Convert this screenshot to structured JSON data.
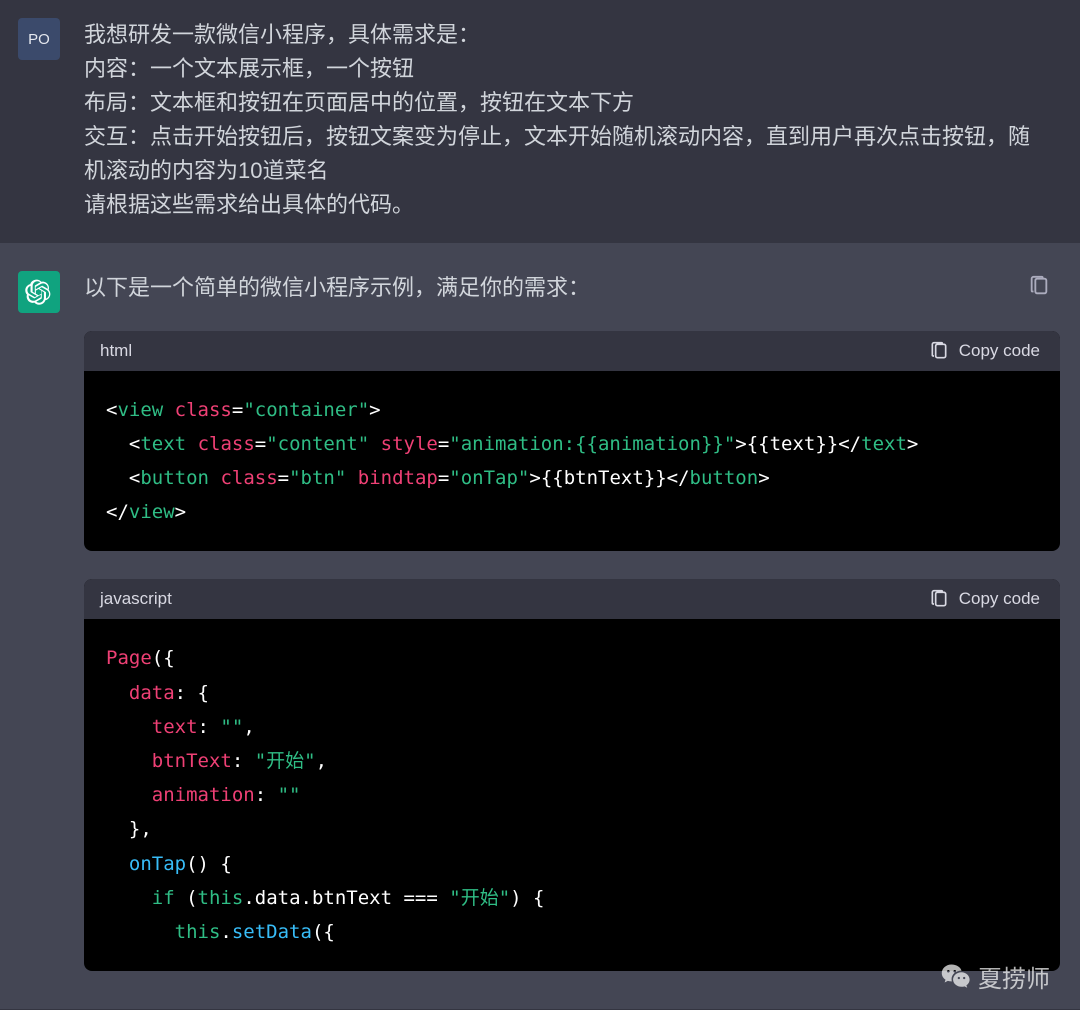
{
  "user": {
    "avatar_label": "PO",
    "message": "我想研发一款微信小程序，具体需求是：\n内容：一个文本展示框，一个按钮\n布局：文本框和按钮在页面居中的位置，按钮在文本下方\n交互：点击开始按钮后，按钮文案变为停止，文本开始随机滚动内容，直到用户再次点击按钮，随机滚动的内容为10道菜名\n请根据这些需求给出具体的代码。"
  },
  "assistant": {
    "intro": "以下是一个简单的微信小程序示例，满足你的需求：",
    "copy_label": "Copy code",
    "code_blocks": [
      {
        "lang": "html",
        "tokens": [
          [
            [
              "punct",
              "<"
            ],
            [
              "tag",
              "view"
            ],
            [
              "text",
              " "
            ],
            [
              "attr",
              "class"
            ],
            [
              "punct",
              "="
            ],
            [
              "string",
              "\"container\""
            ],
            [
              "punct",
              ">"
            ]
          ],
          [
            [
              "text",
              "  "
            ],
            [
              "punct",
              "<"
            ],
            [
              "tag",
              "text"
            ],
            [
              "text",
              " "
            ],
            [
              "attr",
              "class"
            ],
            [
              "punct",
              "="
            ],
            [
              "string",
              "\"content\""
            ],
            [
              "text",
              " "
            ],
            [
              "attr",
              "style"
            ],
            [
              "punct",
              "="
            ],
            [
              "string",
              "\"animation:{{animation}}\""
            ],
            [
              "punct",
              ">"
            ],
            [
              "text",
              "{{text}}"
            ],
            [
              "punct",
              "</"
            ],
            [
              "tag",
              "text"
            ],
            [
              "punct",
              ">"
            ]
          ],
          [
            [
              "text",
              "  "
            ],
            [
              "punct",
              "<"
            ],
            [
              "tag",
              "button"
            ],
            [
              "text",
              " "
            ],
            [
              "attr",
              "class"
            ],
            [
              "punct",
              "="
            ],
            [
              "string",
              "\"btn\""
            ],
            [
              "text",
              " "
            ],
            [
              "attr",
              "bindtap"
            ],
            [
              "punct",
              "="
            ],
            [
              "string",
              "\"onTap\""
            ],
            [
              "punct",
              ">"
            ],
            [
              "text",
              "{{btnText}}"
            ],
            [
              "punct",
              "</"
            ],
            [
              "tag",
              "button"
            ],
            [
              "punct",
              ">"
            ]
          ],
          [
            [
              "punct",
              "</"
            ],
            [
              "tag",
              "view"
            ],
            [
              "punct",
              ">"
            ]
          ]
        ]
      },
      {
        "lang": "javascript",
        "tokens": [
          [
            [
              "func",
              "Page"
            ],
            [
              "punct",
              "({"
            ]
          ],
          [
            [
              "text",
              "  "
            ],
            [
              "key",
              "data"
            ],
            [
              "punct",
              ": {"
            ]
          ],
          [
            [
              "text",
              "    "
            ],
            [
              "key",
              "text"
            ],
            [
              "punct",
              ": "
            ],
            [
              "string",
              "\"\""
            ],
            [
              "punct",
              ","
            ]
          ],
          [
            [
              "text",
              "    "
            ],
            [
              "key",
              "btnText"
            ],
            [
              "punct",
              ": "
            ],
            [
              "string",
              "\"开始\""
            ],
            [
              "punct",
              ","
            ]
          ],
          [
            [
              "text",
              "    "
            ],
            [
              "key",
              "animation"
            ],
            [
              "punct",
              ": "
            ],
            [
              "string",
              "\"\""
            ]
          ],
          [
            [
              "text",
              "  "
            ],
            [
              "punct",
              "},"
            ]
          ],
          [
            [
              "text",
              "  "
            ],
            [
              "method",
              "onTap"
            ],
            [
              "punct",
              "() {"
            ]
          ],
          [
            [
              "text",
              "    "
            ],
            [
              "kw",
              "if"
            ],
            [
              "punct",
              " ("
            ],
            [
              "this",
              "this"
            ],
            [
              "dot",
              "."
            ],
            [
              "text",
              "data"
            ],
            [
              "dot",
              "."
            ],
            [
              "text",
              "btnText === "
            ],
            [
              "string",
              "\"开始\""
            ],
            [
              "punct",
              ") {"
            ]
          ],
          [
            [
              "text",
              "      "
            ],
            [
              "this",
              "this"
            ],
            [
              "dot",
              "."
            ],
            [
              "method",
              "setData"
            ],
            [
              "punct",
              "({"
            ]
          ]
        ]
      }
    ]
  },
  "watermark": "夏捞师"
}
